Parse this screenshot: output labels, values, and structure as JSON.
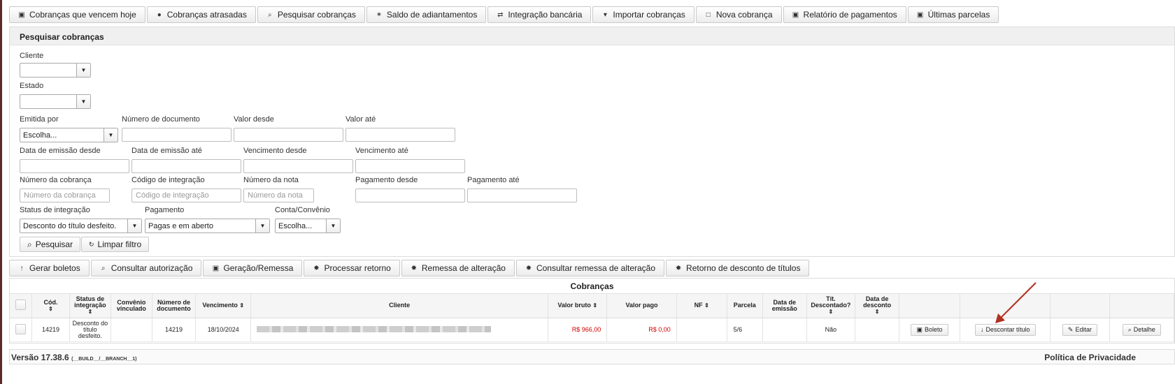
{
  "top_toolbar": [
    {
      "label": "Cobranças que vencem hoje",
      "icon": "calendar-icon",
      "glyph": "▣"
    },
    {
      "label": "Cobranças atrasadas",
      "icon": "clock-icon",
      "glyph": "●"
    },
    {
      "label": "Pesquisar cobranças",
      "icon": "search-icon",
      "glyph": "⌕"
    },
    {
      "label": "Saldo de adiantamentos",
      "icon": "pin-icon",
      "glyph": "✶"
    },
    {
      "label": "Integração bancária",
      "icon": "transfer-icon",
      "glyph": "⇄"
    },
    {
      "label": "Importar cobranças",
      "icon": "caret-down-icon",
      "glyph": "▾"
    },
    {
      "label": "Nova cobrança",
      "icon": "document-icon",
      "glyph": "□"
    },
    {
      "label": "Relatório de pagamentos",
      "icon": "report-icon",
      "glyph": "▣"
    },
    {
      "label": "Últimas parcelas",
      "icon": "calendar-icon",
      "glyph": "▣"
    }
  ],
  "search": {
    "title": "Pesquisar cobranças",
    "cliente_label": "Cliente",
    "estado_label": "Estado",
    "emitida_por_label": "Emitida por",
    "emitida_por_value": "Escolha...",
    "numero_documento_label": "Número de documento",
    "valor_desde_label": "Valor desde",
    "valor_ate_label": "Valor até",
    "data_emissao_desde_label": "Data de emissão desde",
    "data_emissao_ate_label": "Data de emissão até",
    "vencimento_desde_label": "Vencimento desde",
    "vencimento_ate_label": "Vencimento até",
    "numero_cobranca_label": "Número da cobrança",
    "numero_cobranca_placeholder": "Número da cobrança",
    "codigo_integracao_label": "Código de integração",
    "codigo_integracao_placeholder": "Código de integração",
    "numero_nota_label": "Número da nota",
    "numero_nota_placeholder": "Número da nota",
    "pagamento_desde_label": "Pagamento desde",
    "pagamento_ate_label": "Pagamento até",
    "status_integracao_label": "Status de integração",
    "status_integracao_value": "Desconto do título desfeito.",
    "pagamento_label": "Pagamento",
    "pagamento_value": "Pagas e em aberto",
    "conta_convenio_label": "Conta/Convênio",
    "conta_convenio_value": "Escolha...",
    "pesquisar_button": "Pesquisar",
    "limpar_button": "Limpar filtro"
  },
  "mid_toolbar": [
    {
      "label": "Gerar boletos",
      "icon": "upload-icon",
      "glyph": "↑"
    },
    {
      "label": "Consultar autorização",
      "icon": "search-icon",
      "glyph": "⌕"
    },
    {
      "label": "Geração/Remessa",
      "icon": "export-icon",
      "glyph": "▣"
    },
    {
      "label": "Processar retorno",
      "icon": "gear-icon",
      "glyph": "✸"
    },
    {
      "label": "Remessa de alteração",
      "icon": "gear-icon",
      "glyph": "✸"
    },
    {
      "label": "Consultar remessa de alteração",
      "icon": "gear-icon",
      "glyph": "✸"
    },
    {
      "label": "Retorno de desconto de títulos",
      "icon": "gear-icon",
      "glyph": "✸"
    }
  ],
  "table": {
    "title": "Cobranças",
    "headers": {
      "cod": "Cód.",
      "status": "Status de integração",
      "convenio": "Convênio vinculado",
      "numero_documento": "Número de documento",
      "vencimento": "Vencimento",
      "cliente": "Cliente",
      "valor_bruto": "Valor bruto",
      "valor_pago": "Valor pago",
      "nf": "NF",
      "parcela": "Parcela",
      "data_emissao": "Data de emissão",
      "tit_descontado": "Tít. Descontado?",
      "data_desconto": "Data de desconto"
    },
    "rows": [
      {
        "cod": "14219",
        "status": "Desconto do título desfeito.",
        "convenio": "",
        "numero_documento": "14219",
        "vencimento": "18/10/2024",
        "valor_bruto": "R$ 966,00",
        "valor_pago": "R$ 0,00",
        "nf": "",
        "parcela": "5/6",
        "data_emissao": "",
        "tit_descontado": "Não",
        "data_desconto": "",
        "boleto_button": "Boleto",
        "descontar_button": "Descontar título",
        "editar_button": "Editar",
        "detalhe_button": "Detalhe"
      }
    ]
  },
  "footer": {
    "version": "Versão 17.38.6",
    "build": "(__BUILD__/__BRANCH__1)",
    "privacy": "Política de Privacidade"
  },
  "colors": {
    "negative_value": "#d40000",
    "annotation_arrow": "#b03020"
  }
}
